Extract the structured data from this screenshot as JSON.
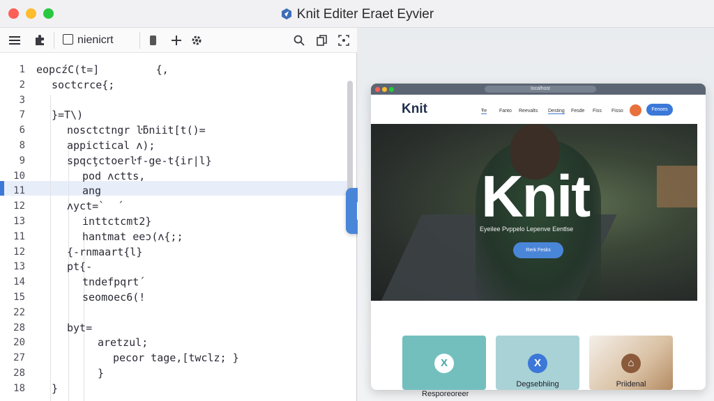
{
  "window": {
    "title": "Knit Editer Eraet Eyvier"
  },
  "toolbar": {
    "tab_label": "nienicrt"
  },
  "editor": {
    "lines": [
      {
        "num": "1",
        "code": "eopcźC(t=]         {,",
        "indent": 0
      },
      {
        "num": "2",
        "code": "soctcrce{;",
        "indent": 1
      },
      {
        "num": "3",
        "code": "",
        "indent": 0
      },
      {
        "num": "7",
        "code": "}=T\\)",
        "indent": 1
      },
      {
        "num": "6",
        "code": "nosctctngr ŀƃniit[t()=",
        "indent": 2
      },
      {
        "num": "8",
        "code": "appictical ʌ);",
        "indent": 2
      },
      {
        "num": "9",
        "code": "spqcţctoerŀf-ge-t{ir|l}",
        "indent": 2
      },
      {
        "num": "10",
        "code": "pod ʌctts,",
        "indent": 3
      },
      {
        "num": "11",
        "code": "ang",
        "indent": 3
      },
      {
        "num": "12",
        "code": "ʌyct=`  ´",
        "indent": 2
      },
      {
        "num": "13",
        "code": "inttctcmt2}",
        "indent": 3
      },
      {
        "num": "11",
        "code": "hantmat eeɔ(ʌ{;;",
        "indent": 3
      },
      {
        "num": "12",
        "code": "{-rnmaart{l}",
        "indent": 2
      },
      {
        "num": "13",
        "code": "pt{-",
        "indent": 2
      },
      {
        "num": "14",
        "code": "tndefpqrt´",
        "indent": 3
      },
      {
        "num": "15",
        "code": "seomoec6(!",
        "indent": 3
      },
      {
        "num": "22",
        "code": "",
        "indent": 0
      },
      {
        "num": "28",
        "code": "byt=",
        "indent": 2
      },
      {
        "num": "20",
        "code": "aretzul;",
        "indent": 4
      },
      {
        "num": "27",
        "code": "pecor tage,[twclz; }",
        "indent": 5
      },
      {
        "num": "28",
        "code": "}",
        "indent": 4
      },
      {
        "num": "18",
        "code": "}",
        "indent": 1
      }
    ]
  },
  "preview": {
    "url": "localhost",
    "site": {
      "brand": "Knit",
      "nav": [
        "Ŧe",
        "Fanto",
        "Reevalts",
        "Desting",
        "Fesde",
        "Fiss",
        "Fisso"
      ],
      "cta": "Fenoes",
      "hero_title": "Knit",
      "hero_subtitle": "Eyeilee Pvppelo Lepenve Eentlse",
      "hero_button": "Rerk Fesks",
      "cards": [
        {
          "icon": "X",
          "label": ""
        },
        {
          "icon": "X",
          "label": "Degsebhiing"
        },
        {
          "icon": "⌂",
          "label": "Priidenal"
        }
      ],
      "caption": "Resporeoreer"
    }
  },
  "colors": {
    "accent": "#3c78d8",
    "teal": "#73bfbe",
    "orange": "#e8703a"
  }
}
